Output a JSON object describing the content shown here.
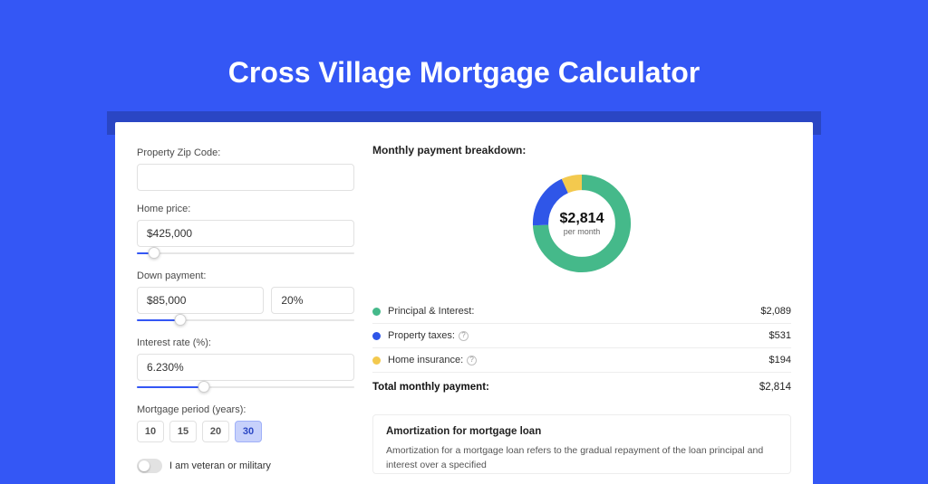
{
  "page_title": "Cross Village Mortgage Calculator",
  "colors": {
    "principal": "#45b98a",
    "taxes": "#2f56e8",
    "insurance": "#f3c94e"
  },
  "form": {
    "zip_label": "Property Zip Code:",
    "zip_value": "",
    "home_price_label": "Home price:",
    "home_price_value": "$425,000",
    "home_price_slider_pct": 8,
    "down_payment_label": "Down payment:",
    "down_payment_value": "$85,000",
    "down_payment_pct_value": "20%",
    "down_payment_slider_pct": 20,
    "interest_label": "Interest rate (%):",
    "interest_value": "6.230%",
    "interest_slider_pct": 31,
    "period_label": "Mortgage period (years):",
    "period_options": [
      "10",
      "15",
      "20",
      "30"
    ],
    "period_selected": "30",
    "veteran_label": "I am veteran or military",
    "veteran_on": false
  },
  "breakdown": {
    "title": "Monthly payment breakdown:",
    "donut_amount": "$2,814",
    "donut_sub": "per month",
    "items": [
      {
        "label": "Principal & Interest:",
        "value": "$2,089",
        "color": "#45b98a",
        "info": false,
        "share": 0.742
      },
      {
        "label": "Property taxes:",
        "value": "$531",
        "color": "#2f56e8",
        "info": true,
        "share": 0.189
      },
      {
        "label": "Home insurance:",
        "value": "$194",
        "color": "#f3c94e",
        "info": true,
        "share": 0.069
      }
    ],
    "total_label": "Total monthly payment:",
    "total_value": "$2,814"
  },
  "amortization": {
    "title": "Amortization for mortgage loan",
    "text": "Amortization for a mortgage loan refers to the gradual repayment of the loan principal and interest over a specified"
  },
  "chart_data": {
    "type": "pie",
    "title": "Monthly payment breakdown",
    "series": [
      {
        "name": "Principal & Interest",
        "value": 2089
      },
      {
        "name": "Property taxes",
        "value": 531
      },
      {
        "name": "Home insurance",
        "value": 194
      }
    ],
    "total": 2814,
    "unit": "USD per month"
  }
}
